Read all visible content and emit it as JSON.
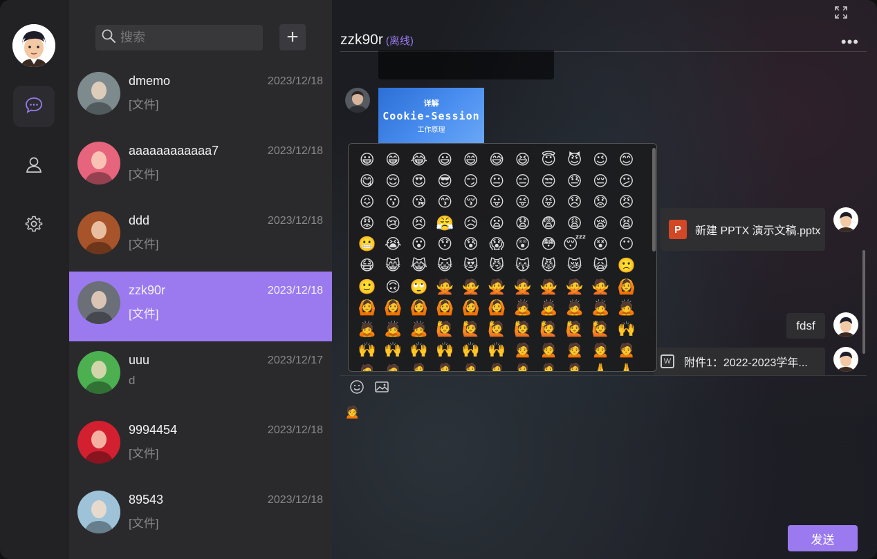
{
  "sidebar": {
    "nav": [
      {
        "name": "chat-nav-button",
        "icon": "chat-bubble-icon",
        "active": true
      },
      {
        "name": "contacts-nav-button",
        "icon": "user-icon",
        "active": false
      },
      {
        "name": "settings-nav-button",
        "icon": "gear-icon",
        "active": false
      }
    ]
  },
  "search": {
    "placeholder": "搜索"
  },
  "add_label": "+",
  "contacts": [
    {
      "name": "dmemo",
      "date": "2023/12/18",
      "msg": "[文件]",
      "color": "#7d8a8e"
    },
    {
      "name": "aaaaaaaaaaaa7",
      "date": "2023/12/18",
      "msg": "[文件]",
      "color": "#e7657c"
    },
    {
      "name": "ddd",
      "date": "2023/12/18",
      "msg": "[文件]",
      "color": "#a8542a"
    },
    {
      "name": "zzk90r",
      "date": "2023/12/18",
      "msg": "[文件]",
      "color": "#6b6f78",
      "active": true
    },
    {
      "name": "uuu",
      "date": "2023/12/17",
      "msg": "d",
      "color": "#4caf50"
    },
    {
      "name": "9994454",
      "date": "2023/12/18",
      "msg": "[文件]",
      "color": "#d22030"
    },
    {
      "name": "89543",
      "date": "2023/12/18",
      "msg": "[文件]",
      "color": "#9ec3d8"
    }
  ],
  "chat": {
    "title": "zzk90r",
    "status": "(离线)",
    "more": "•••",
    "cookie_image": {
      "line1": "详解",
      "line2": "Cookie-Session",
      "line3": "工作原理"
    },
    "file1": "新建 PPTX 演示文稿.pptx",
    "file1_icon": "P",
    "text_msg": "fdsf",
    "file2": "附件1：2022-2023学年...",
    "file2_icon": "W",
    "typed": "🙍",
    "send_label": "发送"
  },
  "emojis": [
    "😀",
    "😁",
    "😂",
    "😃",
    "😄",
    "😅",
    "😆",
    "😇",
    "😈",
    "😉",
    "😊",
    "😋",
    "😌",
    "😍",
    "😎",
    "😏",
    "😐",
    "😑",
    "😒",
    "😓",
    "😔",
    "😕",
    "😖",
    "😗",
    "😘",
    "😙",
    "😚",
    "😛",
    "😜",
    "😝",
    "😞",
    "😟",
    "😠",
    "😡",
    "😢",
    "😣",
    "😤",
    "😥",
    "😦",
    "😧",
    "😨",
    "😩",
    "😪",
    "😫",
    "😬",
    "😭",
    "😮",
    "😯",
    "😰",
    "😱",
    "😲",
    "😳",
    "😴",
    "😵",
    "😶",
    "😷",
    "😸",
    "😹",
    "😺",
    "😻",
    "😼",
    "😽",
    "😾",
    "😿",
    "🙀",
    "🙁",
    "🙂",
    "🙃",
    "🙄",
    "🙅",
    "🙅",
    "🙅",
    "🙅",
    "🙅",
    "🙅",
    "🙅",
    "🙆",
    "🙆",
    "🙆",
    "🙆",
    "🙆",
    "🙆",
    "🙆",
    "🙇",
    "🙇",
    "🙇",
    "🙇",
    "🙇",
    "🙇",
    "🙇",
    "🙇",
    "🙋",
    "🙋",
    "🙋",
    "🙋",
    "🙋",
    "🙋",
    "🙋",
    "🙌",
    "🙌",
    "🙌",
    "🙌",
    "🙌",
    "🙌",
    "🙌",
    "🙍",
    "🙍",
    "🙍",
    "🙍",
    "🙍",
    "🙍",
    "🙍",
    "🙎",
    "🙎",
    "🙎",
    "🙎",
    "🙎",
    "🙎",
    "🙎",
    "🙏",
    "🙏"
  ],
  "colors": {
    "accent": "#9b7af0",
    "sidebar": "#222225",
    "list": "#2a2a2d"
  }
}
